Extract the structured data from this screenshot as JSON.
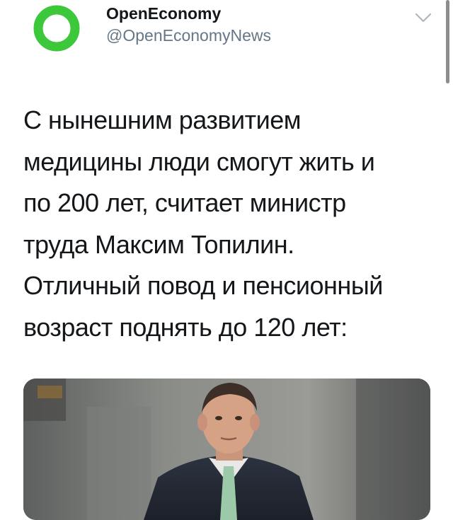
{
  "account": {
    "display_name": "OpenEconomy",
    "handle": "@OpenEconomyNews",
    "avatar_icon": "green-ring-logo-icon",
    "avatar_color": "#3cc83a"
  },
  "menu": {
    "icon": "chevron-down-icon"
  },
  "tweet": {
    "lines": [
      "С нынешним развитием",
      "медицины люди смогут жить и",
      "по 200 лет, считает министр",
      "труда Максим Топилин.",
      "Отличный повод и пенсионный",
      "возраст поднять до 120 лет:"
    ]
  },
  "media": {
    "kind": "photo",
    "subject": "man-in-suit-photo"
  }
}
